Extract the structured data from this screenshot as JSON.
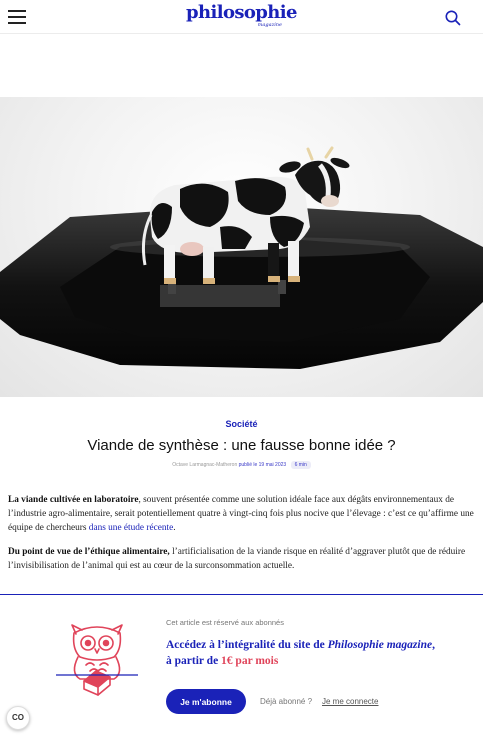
{
  "header": {
    "logo_main": "philosophie",
    "logo_sub": "magazine",
    "menu_icon": "hamburger-menu-icon",
    "search_icon": "search-icon",
    "accent_color": "#1a22b8"
  },
  "hero": {
    "image_subject": "cow-figurine-on-black-plate"
  },
  "article": {
    "category": "Société",
    "title": "Viande de synthèse : une fausse bonne idée ?",
    "author": "Octave Larmagnac-Matheron",
    "published": "publié le 19 mai 2023",
    "reading_time": "6 min",
    "p1_lead": "La viande cultivée en laboratoire",
    "p1_text": ", souvent présentée comme une solution idéale face aux dégâts environnementaux de l’industrie agro-alimentaire, serait potentiellement quatre à vingt-cinq fois plus nocive que l’élevage : c’est ce qu’affirme une équipe de chercheurs ",
    "p1_link": "dans une étude récente",
    "p1_end": ".",
    "p2_lead": "Du point de vue de l’éthique alimentaire,",
    "p2_text": " l’artificialisation de la viande risque en réalité d’aggraver plutôt que de réduire l’invisibilisation de l’animal qui est au cœur de la surconsommation actuelle."
  },
  "paywall": {
    "reserved": "Cet article est réservé aux abonnés",
    "offer_prefix": "Accédez à l’intégralité du site de ",
    "offer_magazine": "Philosophie magazine",
    "offer_middle": ", à partir de ",
    "offer_price": "1€ par mois",
    "subscribe_label": "Je m'abonne",
    "already": "Déjà abonné ?",
    "login_label": "Je me connecte",
    "illustration": "owl-reading-book-icon"
  },
  "cookie_button": {
    "label": "CO"
  }
}
